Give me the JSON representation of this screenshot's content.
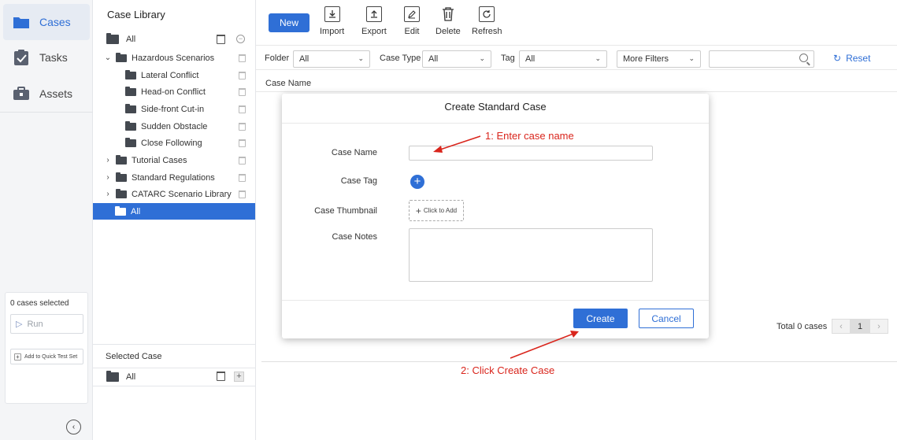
{
  "nav": {
    "items": [
      {
        "label": "Cases",
        "icon": "folder-icon"
      },
      {
        "label": "Tasks",
        "icon": "clipboard-check-icon"
      },
      {
        "label": "Assets",
        "icon": "toolbox-icon"
      }
    ],
    "selected_count": "0 cases selected",
    "run_label": "Run",
    "quick_test_label": "Add to Quick Test Set"
  },
  "tree": {
    "title": "Case Library",
    "root": "All",
    "nodes": [
      {
        "label": "Hazardous Scenarios",
        "expanded": true
      },
      {
        "label": "Lateral Conflict"
      },
      {
        "label": "Head-on Conflict"
      },
      {
        "label": "Side-front Cut-in"
      },
      {
        "label": "Sudden Obstacle"
      },
      {
        "label": "Close Following"
      },
      {
        "label": "Tutorial Cases",
        "expanded": false
      },
      {
        "label": "Standard Regulations",
        "expanded": false
      },
      {
        "label": "CATARC Scenario Library",
        "expanded": false
      },
      {
        "label": "All",
        "selected": true
      }
    ],
    "selected_case_title": "Selected Case",
    "selected_case_root": "All"
  },
  "toolbar": {
    "new": "New",
    "import": "Import",
    "export": "Export",
    "edit": "Edit",
    "delete": "Delete",
    "refresh": "Refresh"
  },
  "filters": {
    "folder_label": "Folder",
    "folder_value": "All",
    "case_type_label": "Case Type",
    "case_type_value": "All",
    "tag_label": "Tag",
    "tag_value": "All",
    "more_filters": "More Filters",
    "search_placeholder": "",
    "reset": "Reset"
  },
  "table": {
    "column_case_name": "Case Name",
    "total": "Total 0 cases",
    "page": "1"
  },
  "modal": {
    "title": "Create Standard Case",
    "case_name_label": "Case Name",
    "case_name_value": "",
    "case_tag_label": "Case Tag",
    "case_thumbnail_label": "Case Thumbnail",
    "thumbnail_add": "Click to Add",
    "case_notes_label": "Case Notes",
    "create": "Create",
    "cancel": "Cancel"
  },
  "annotations": {
    "step1": "1:  Enter case name",
    "step2": "2:  Click Create Case",
    "color": "#d9251c"
  },
  "colors": {
    "accent": "#2f6fd6"
  }
}
